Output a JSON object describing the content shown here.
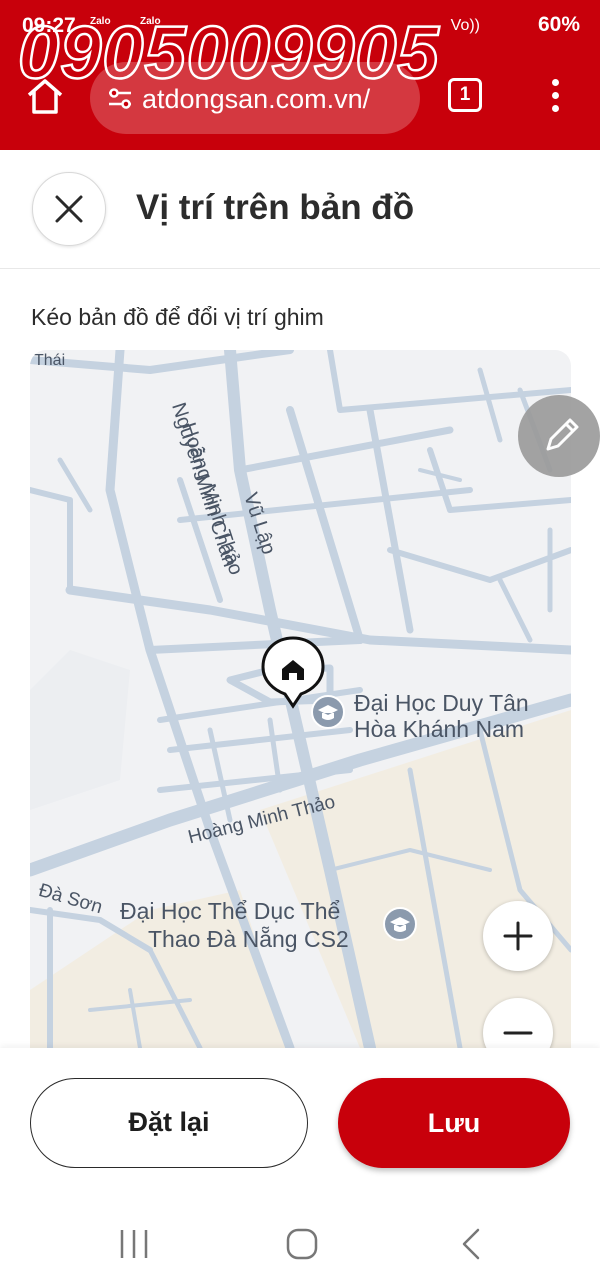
{
  "status_bar": {
    "time": "09:27",
    "notifications": [
      "Zalo",
      "Zalo"
    ],
    "signal_label": "Vo))",
    "battery": "60%"
  },
  "watermark": "0905009905",
  "browser": {
    "url": "atdongsan.com.vn/",
    "tab_count": "1",
    "icons": [
      "home-icon",
      "site-settings-icon",
      "tab-switcher-icon",
      "overflow-menu-icon"
    ]
  },
  "header": {
    "title": "Vị trí trên bản đồ"
  },
  "hint": "Kéo bản đồ để đổi vị trí ghim",
  "map": {
    "streets": [
      "Hoàng Minh Thảo",
      "Nguyễn Minh Chấn",
      "Vũ Lập",
      "Hoàng Minh Thảo",
      "Đà Sơn",
      "Thái"
    ],
    "pois": [
      {
        "line1": "Đại Học Duy Tân",
        "line2": "Hòa Khánh Nam"
      },
      {
        "line1": "Đại Học Thể Dục Thể",
        "line2": "Thao Đà Nẵng CS2"
      }
    ],
    "zoom_in": "+",
    "zoom_out": "−",
    "colors": {
      "road": "#c5d2e0",
      "land": "#f1f2f4",
      "sand": "#f2ede2",
      "pin": "#111111"
    }
  },
  "footer": {
    "reset_label": "Đặt lại",
    "save_label": "Lưu"
  },
  "colors": {
    "brand": "#c8000b"
  }
}
